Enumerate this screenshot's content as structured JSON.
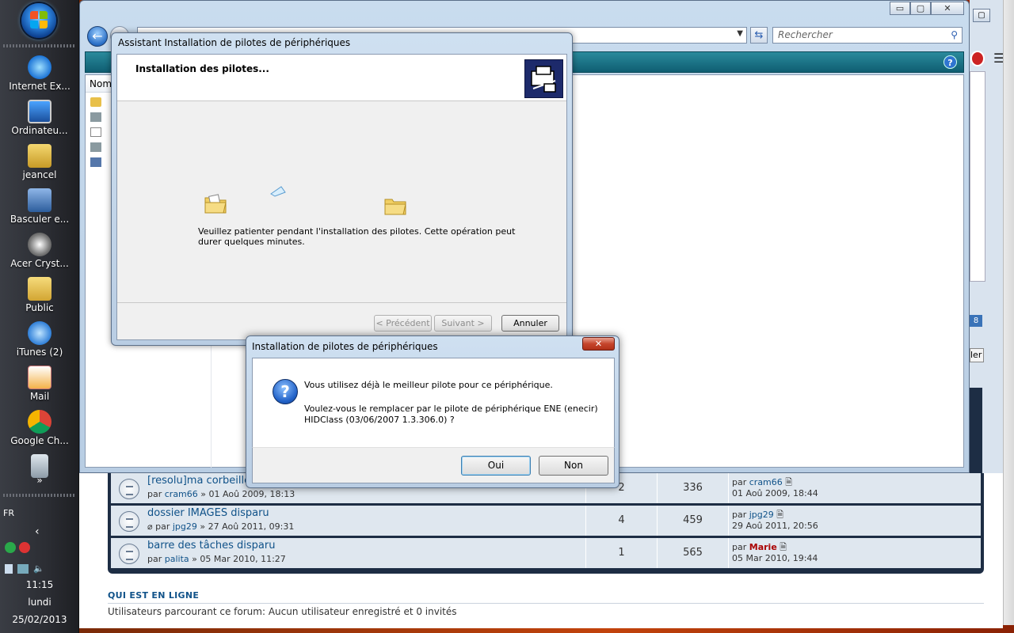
{
  "desktop": {
    "icons": [
      {
        "label": "Internet Ex...",
        "icon": "internet-explorer-icon"
      },
      {
        "label": "Ordinateu...",
        "icon": "computer-icon"
      },
      {
        "label": "jeancel",
        "icon": "user-folder-icon"
      },
      {
        "label": "Basculer e...",
        "icon": "switch-windows-icon"
      },
      {
        "label": "Acer Cryst...",
        "icon": "webcam-icon"
      },
      {
        "label": "Public",
        "icon": "folder-icon"
      },
      {
        "label": "iTunes (2)",
        "icon": "itunes-icon"
      },
      {
        "label": "Mail",
        "icon": "mail-icon"
      },
      {
        "label": "Google Ch...",
        "icon": "chrome-icon"
      }
    ],
    "more_chevron": "»"
  },
  "taskbar": {
    "language": "FR",
    "collapse_arrow": "‹",
    "time": "11:15",
    "day": "lundi",
    "date": "25/02/2013"
  },
  "explorer": {
    "search_placeholder": "Rechercher",
    "column_header": "Nom",
    "window_buttons": {
      "minimize": "▭",
      "maximize": "▢",
      "close": "✕"
    }
  },
  "wizard": {
    "title": "Assistant Installation de pilotes de périphériques",
    "header": "Installation des pilotes...",
    "message": "Veuillez patienter pendant l'installation des pilotes. Cette opération peut durer quelques minutes.",
    "buttons": {
      "back": "< Précédent",
      "next": "Suivant >",
      "cancel": "Annuler"
    }
  },
  "confirm": {
    "title": "Installation de pilotes de périphériques",
    "close": "✕",
    "line1": "Vous utilisez déjà le meilleur pilote pour ce périphérique.",
    "line2": "Voulez-vous le remplacer par le pilote de périphérique ENE (enecir) HIDClass  (03/06/2007 1.3.306.0) ?",
    "buttons": {
      "yes": "Oui",
      "no": "Non"
    }
  },
  "forum": {
    "rows": [
      {
        "title": "[resolu]ma corbeille",
        "by": "par",
        "author": "cram66",
        "date": "» 01 Aoû 2009, 18:13",
        "replies": "2",
        "views": "336",
        "last_by": "par",
        "last_author": "cram66",
        "last_date": "01 Aoû 2009, 18:44",
        "attachment": false
      },
      {
        "title": "dossier IMAGES disparu",
        "by": "par",
        "author": "jpg29",
        "date": "» 27 Aoû 2011, 09:31",
        "replies": "4",
        "views": "459",
        "last_by": "par",
        "last_author": "jpg29",
        "last_date": "29 Aoû 2011, 20:56",
        "attachment": true
      },
      {
        "title": "barre des tâches disparu",
        "by": "par",
        "author": "palita",
        "date": "» 05 Mar 2010, 11:27",
        "replies": "1",
        "views": "565",
        "last_by": "par",
        "last_author": "Marie",
        "last_date": "05 Mar 2010, 19:44",
        "attachment": false
      }
    ],
    "who_online_title": "QUI EST EN LIGNE",
    "who_online_text": "Utilisateurs parcourant ce forum: Aucun utilisateur enregistré et 0 invités",
    "side_badge": "8",
    "side_button": "ler"
  }
}
